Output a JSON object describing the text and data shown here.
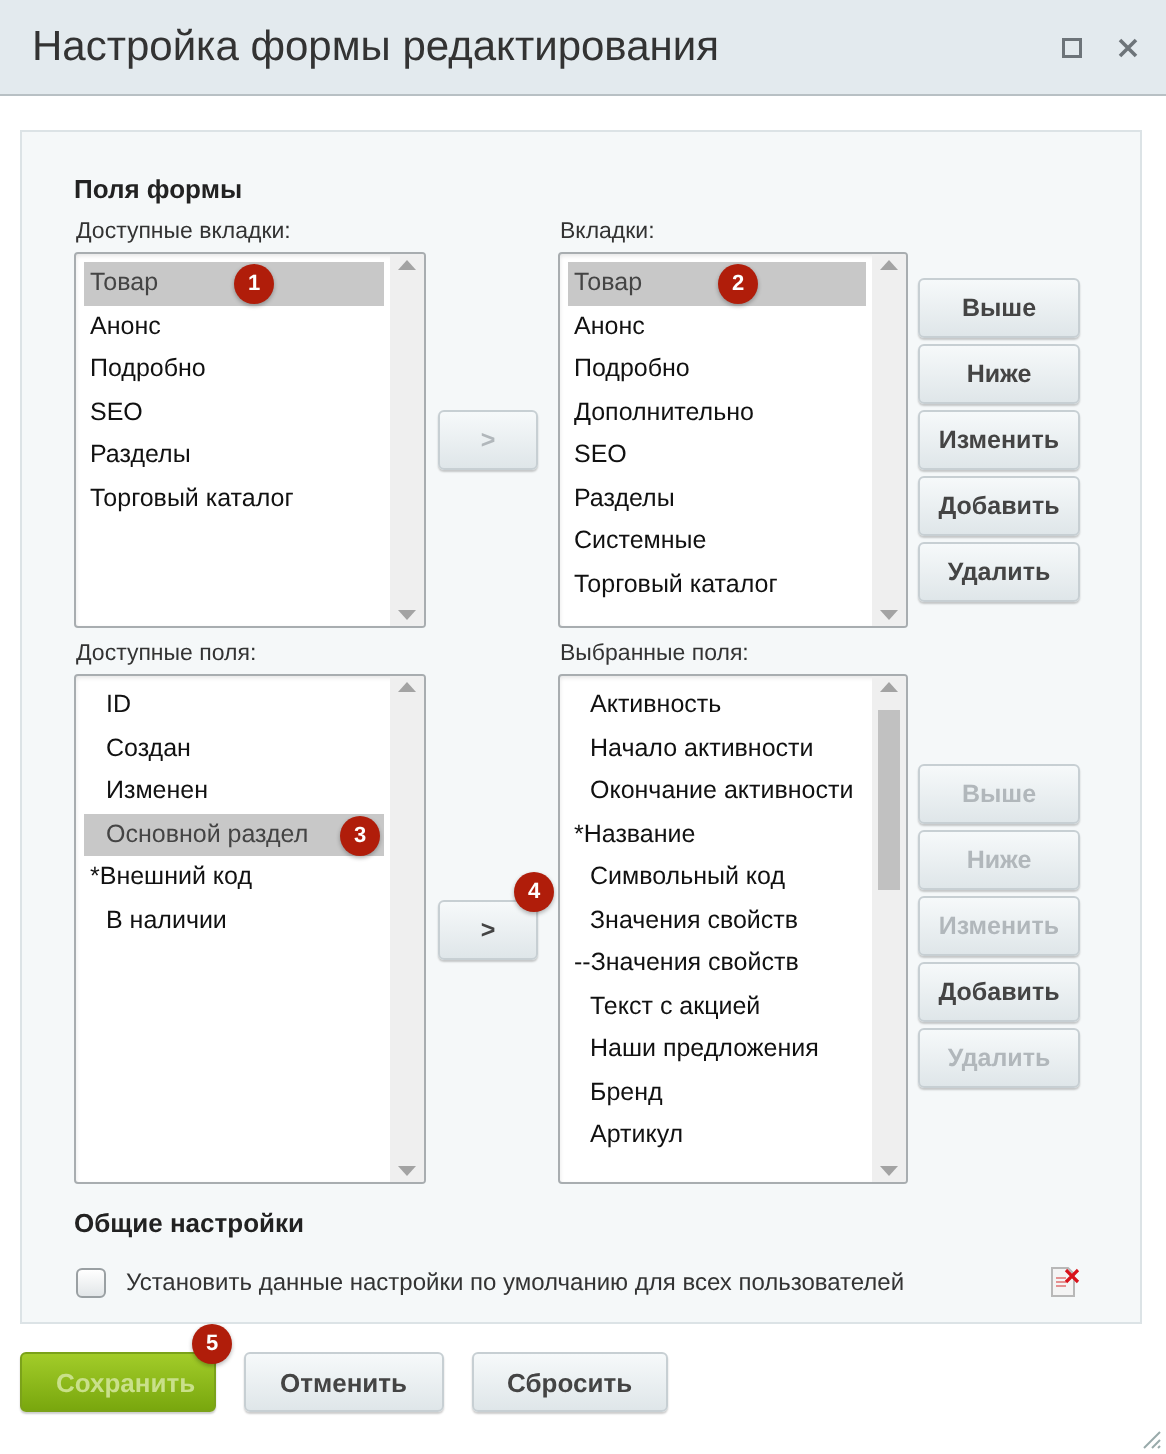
{
  "window": {
    "title": "Настройка формы редактирования"
  },
  "section_title": "Поля формы",
  "tabs_block": {
    "available": {
      "label": "Доступные вкладки:",
      "items": [
        {
          "text": "Товар",
          "selected": true,
          "indented": false,
          "badge": "1"
        },
        {
          "text": "Анонс",
          "selected": false,
          "indented": false
        },
        {
          "text": "Подробно",
          "selected": false,
          "indented": false
        },
        {
          "text": "SEO",
          "selected": false,
          "indented": false
        },
        {
          "text": "Разделы",
          "selected": false,
          "indented": false
        },
        {
          "text": "Торговый каталог",
          "selected": false,
          "indented": false
        }
      ]
    },
    "move_button": {
      "text": ">",
      "disabled": true
    },
    "chosen": {
      "label": "Вкладки:",
      "items": [
        {
          "text": "Товар",
          "selected": true,
          "indented": false,
          "badge": "2"
        },
        {
          "text": "Анонс",
          "selected": false,
          "indented": false
        },
        {
          "text": "Подробно",
          "selected": false,
          "indented": false
        },
        {
          "text": "Дополнительно",
          "selected": false,
          "indented": false
        },
        {
          "text": "SEO",
          "selected": false,
          "indented": false
        },
        {
          "text": "Разделы",
          "selected": false,
          "indented": false
        },
        {
          "text": "Системные",
          "selected": false,
          "indented": false
        },
        {
          "text": "Торговый каталог",
          "selected": false,
          "indented": false
        }
      ]
    },
    "buttons": [
      {
        "text": "Выше",
        "disabled": false
      },
      {
        "text": "Ниже",
        "disabled": false
      },
      {
        "text": "Изменить",
        "disabled": false
      },
      {
        "text": "Добавить",
        "disabled": false
      },
      {
        "text": "Удалить",
        "disabled": false
      }
    ]
  },
  "fields_block": {
    "available": {
      "label": "Доступные поля:",
      "items": [
        {
          "text": "ID",
          "selected": false,
          "indented": true
        },
        {
          "text": "Создан",
          "selected": false,
          "indented": true
        },
        {
          "text": "Изменен",
          "selected": false,
          "indented": true
        },
        {
          "text": "Основной раздел",
          "selected": true,
          "indented": true,
          "badge": "3"
        },
        {
          "text": "*Внешний код",
          "selected": false,
          "indented": false
        },
        {
          "text": "В наличии",
          "selected": false,
          "indented": true
        }
      ]
    },
    "move_button": {
      "text": ">",
      "disabled": false,
      "badge": "4"
    },
    "chosen": {
      "label": "Выбранные поля:",
      "scrollable": true,
      "items": [
        {
          "text": "Активность",
          "selected": false,
          "indented": true
        },
        {
          "text": "Начало активности",
          "selected": false,
          "indented": true
        },
        {
          "text": "Окончание активности",
          "selected": false,
          "indented": true
        },
        {
          "text": "*Название",
          "selected": false,
          "indented": false
        },
        {
          "text": "Символьный код",
          "selected": false,
          "indented": true
        },
        {
          "text": "Значения свойств",
          "selected": false,
          "indented": true
        },
        {
          "text": "--Значения свойств",
          "selected": false,
          "indented": false
        },
        {
          "text": "Текст с акцией",
          "selected": false,
          "indented": true
        },
        {
          "text": "Наши предложения",
          "selected": false,
          "indented": true
        },
        {
          "text": "Бренд",
          "selected": false,
          "indented": true
        },
        {
          "text": "Артикул",
          "selected": false,
          "indented": true
        }
      ]
    },
    "buttons": [
      {
        "text": "Выше",
        "disabled": true
      },
      {
        "text": "Ниже",
        "disabled": true
      },
      {
        "text": "Изменить",
        "disabled": true
      },
      {
        "text": "Добавить",
        "disabled": false
      },
      {
        "text": "Удалить",
        "disabled": true
      }
    ]
  },
  "general": {
    "title": "Общие настройки",
    "checkbox": {
      "label": "Установить данные настройки по умолчанию для всех пользователей",
      "checked": false
    }
  },
  "footer_buttons": [
    {
      "text": "Сохранить",
      "kind": "primary",
      "disabled": true,
      "badge": "5"
    },
    {
      "text": "Отменить",
      "kind": "secondary",
      "disabled": false
    },
    {
      "text": "Сбросить",
      "kind": "secondary",
      "disabled": false
    }
  ]
}
